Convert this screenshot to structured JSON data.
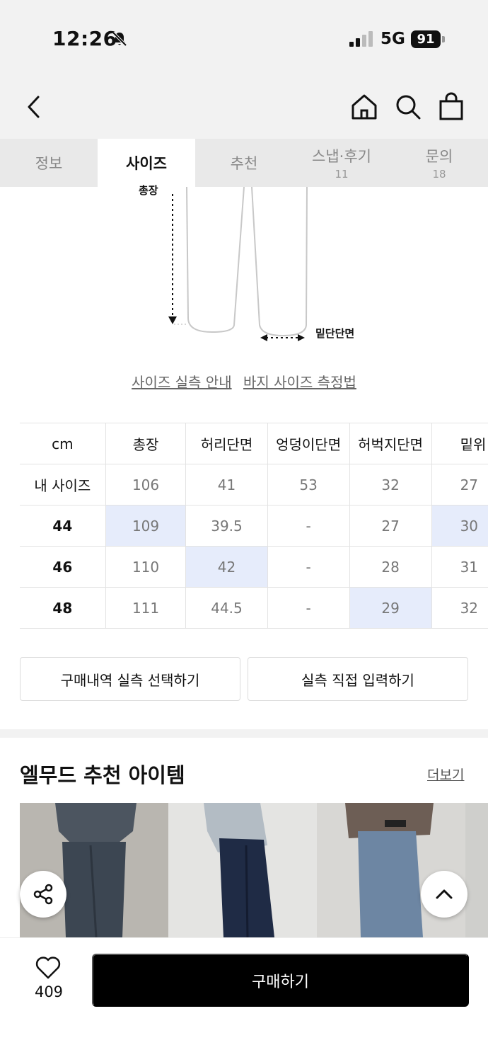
{
  "status_bar": {
    "time": "12:26",
    "network": "5G",
    "battery": "91"
  },
  "nav": {
    "icons": [
      "back-icon",
      "home-icon",
      "search-icon",
      "bag-icon"
    ]
  },
  "tabs": [
    {
      "label": "정보",
      "count": ""
    },
    {
      "label": "사이즈",
      "count": ""
    },
    {
      "label": "추천",
      "count": ""
    },
    {
      "label": "스냅·후기",
      "count": "11"
    },
    {
      "label": "문의",
      "count": "18"
    }
  ],
  "active_tab": "사이즈",
  "diagram": {
    "total_length_label": "총장",
    "hem_label": "밑단단면"
  },
  "guide_links": {
    "actual_size": "사이즈 실측 안내",
    "measure_method": "바지 사이즈 측정법"
  },
  "size_table": {
    "headers": [
      "cm",
      "총장",
      "허리단면",
      "엉덩이단면",
      "허벅지단면",
      "밑위"
    ],
    "rows": [
      {
        "label": "내 사이즈",
        "values": [
          "106",
          "41",
          "53",
          "32",
          "27"
        ]
      },
      {
        "label": "44",
        "values": [
          "109",
          "39.5",
          "-",
          "27",
          "30"
        ]
      },
      {
        "label": "46",
        "values": [
          "110",
          "42",
          "-",
          "28",
          "31"
        ]
      },
      {
        "label": "48",
        "values": [
          "111",
          "44.5",
          "-",
          "29",
          "32"
        ]
      }
    ],
    "highlight_color": "#e6ecfb"
  },
  "actions": {
    "history_select": "구매내역 실측 선택하기",
    "direct_input": "실측 직접 입력하기"
  },
  "recommendation": {
    "title": "엘무드 추천 아이템",
    "more": "더보기"
  },
  "bottom_bar": {
    "like_count": "409",
    "buy_label": "구매하기"
  }
}
